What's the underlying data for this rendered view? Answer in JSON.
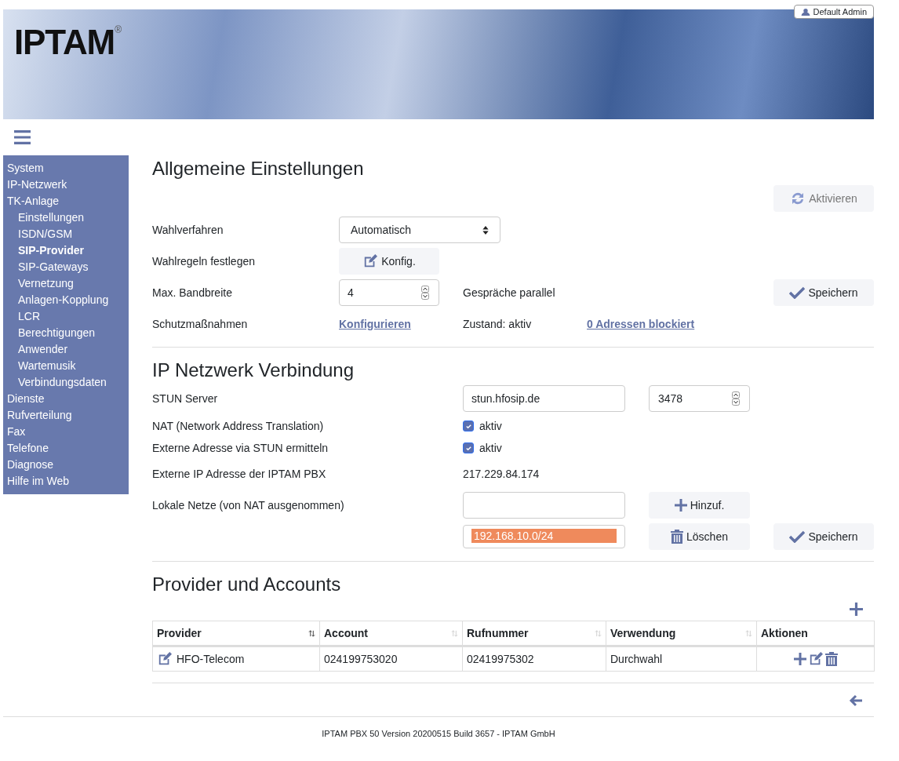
{
  "user_button": {
    "label": "Default Admin"
  },
  "logo": {
    "text": "IPTAM",
    "mark": "®"
  },
  "sidebar": {
    "items": [
      {
        "label": "System",
        "selected": false
      },
      {
        "label": "IP-Netzwerk",
        "selected": false
      },
      {
        "label": "TK-Anlage",
        "selected": false,
        "children": [
          {
            "label": "Einstellungen",
            "selected": false
          },
          {
            "label": "ISDN/GSM",
            "selected": false
          },
          {
            "label": "SIP-Provider",
            "selected": true
          },
          {
            "label": "SIP-Gateways",
            "selected": false
          },
          {
            "label": "Vernetzung",
            "selected": false
          },
          {
            "label": "Anlagen-Kopplung",
            "selected": false
          },
          {
            "label": "LCR",
            "selected": false
          },
          {
            "label": "Berechtigungen",
            "selected": false
          },
          {
            "label": "Anwender",
            "selected": false
          },
          {
            "label": "Wartemusik",
            "selected": false
          },
          {
            "label": "Verbindungsdaten",
            "selected": false
          }
        ]
      },
      {
        "label": "Dienste",
        "selected": false
      },
      {
        "label": "Rufverteilung",
        "selected": false
      },
      {
        "label": "Fax",
        "selected": false
      },
      {
        "label": "Telefone",
        "selected": false
      },
      {
        "label": "Diagnose",
        "selected": false
      },
      {
        "label": "Hilfe im Web",
        "selected": false
      }
    ]
  },
  "general": {
    "title": "Allgemeine Einstellungen",
    "activate_button": {
      "label": "Aktivieren",
      "disabled": true
    },
    "dial_method": {
      "label": "Wahlverfahren",
      "value": "Automatisch"
    },
    "dial_rules": {
      "label": "Wahlregeln festlegen",
      "button": "Konfig."
    },
    "bandwidth": {
      "label": "Max. Bandbreite",
      "value": "4",
      "unit": "Gespräche parallel",
      "button": "Speichern"
    },
    "protection": {
      "label": "Schutzmaßnahmen",
      "link": "Konfigurieren",
      "state": "Zustand: aktiv",
      "blocked_link": "0 Adressen blockiert"
    }
  },
  "network": {
    "title": "IP Netzwerk Verbindung",
    "stun": {
      "label": "STUN Server",
      "value": "stun.hfosip.de",
      "port": "3478"
    },
    "nat": {
      "label": "NAT (Network Address Translation)",
      "option": "aktiv",
      "checked": true
    },
    "stun_external": {
      "label": "Externe Adresse via STUN ermitteln",
      "option": "aktiv",
      "checked": true
    },
    "external_ip": {
      "label": "Externe IP Adresse der IPTAM PBX",
      "value": "217.229.84.174"
    },
    "local_nets": {
      "label": "Lokale Netze (von NAT ausgenommen)",
      "add_button": "Hinzuf.",
      "delete_button": "Löschen",
      "save_button": "Speichern",
      "items": [
        {
          "text": "192.168.10.0/24",
          "selected": true
        }
      ]
    }
  },
  "providers": {
    "title": "Provider und Accounts",
    "table": {
      "columns": [
        {
          "label": "Provider",
          "sorted": true
        },
        {
          "label": "Account",
          "sorted": false
        },
        {
          "label": "Rufnummer",
          "sorted": false
        },
        {
          "label": "Verwendung",
          "sorted": false
        },
        {
          "label": "Aktionen"
        }
      ],
      "rows": [
        {
          "provider": "HFO-Telecom",
          "account": "024199753020",
          "number": "02419975302",
          "usage": "Durchwahl"
        }
      ]
    }
  },
  "footer": "IPTAM PBX 50 Version 20200515 Build 3657 - IPTAM GmbH"
}
